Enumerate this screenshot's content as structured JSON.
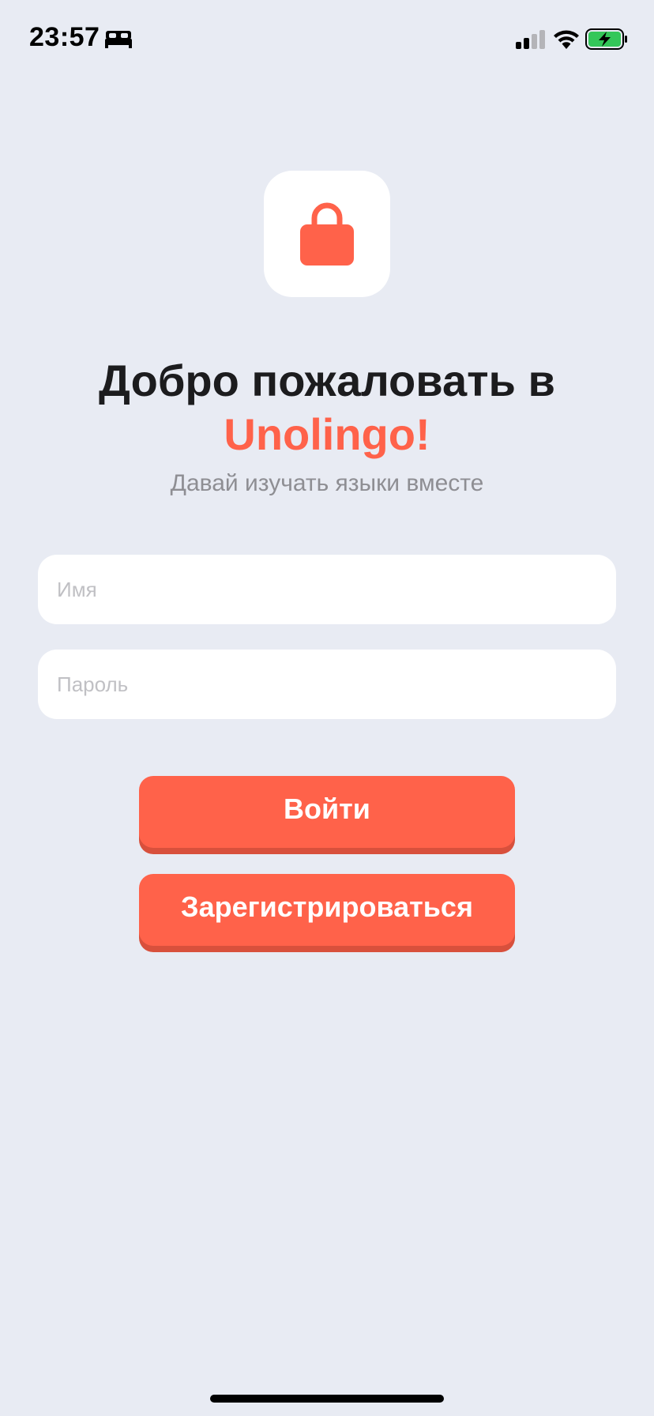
{
  "status_bar": {
    "time": "23:57",
    "icons": [
      "bed-icon",
      "cellular-signal-icon",
      "wifi-icon",
      "battery-charging-icon"
    ],
    "battery_color": "#34c759"
  },
  "logo": {
    "icon": "lock-icon",
    "color": "#ff624a"
  },
  "header": {
    "title": "Добро пожаловать в",
    "brand": "Unolingo!",
    "subtitle": "Давай изучать языки вместе"
  },
  "form": {
    "name_placeholder": "Имя",
    "name_value": "",
    "password_placeholder": "Пароль",
    "password_value": ""
  },
  "actions": {
    "login_label": "Войти",
    "register_label": "Зарегистрироваться"
  },
  "colors": {
    "accent": "#ff624a",
    "background": "#e8ebf3"
  }
}
